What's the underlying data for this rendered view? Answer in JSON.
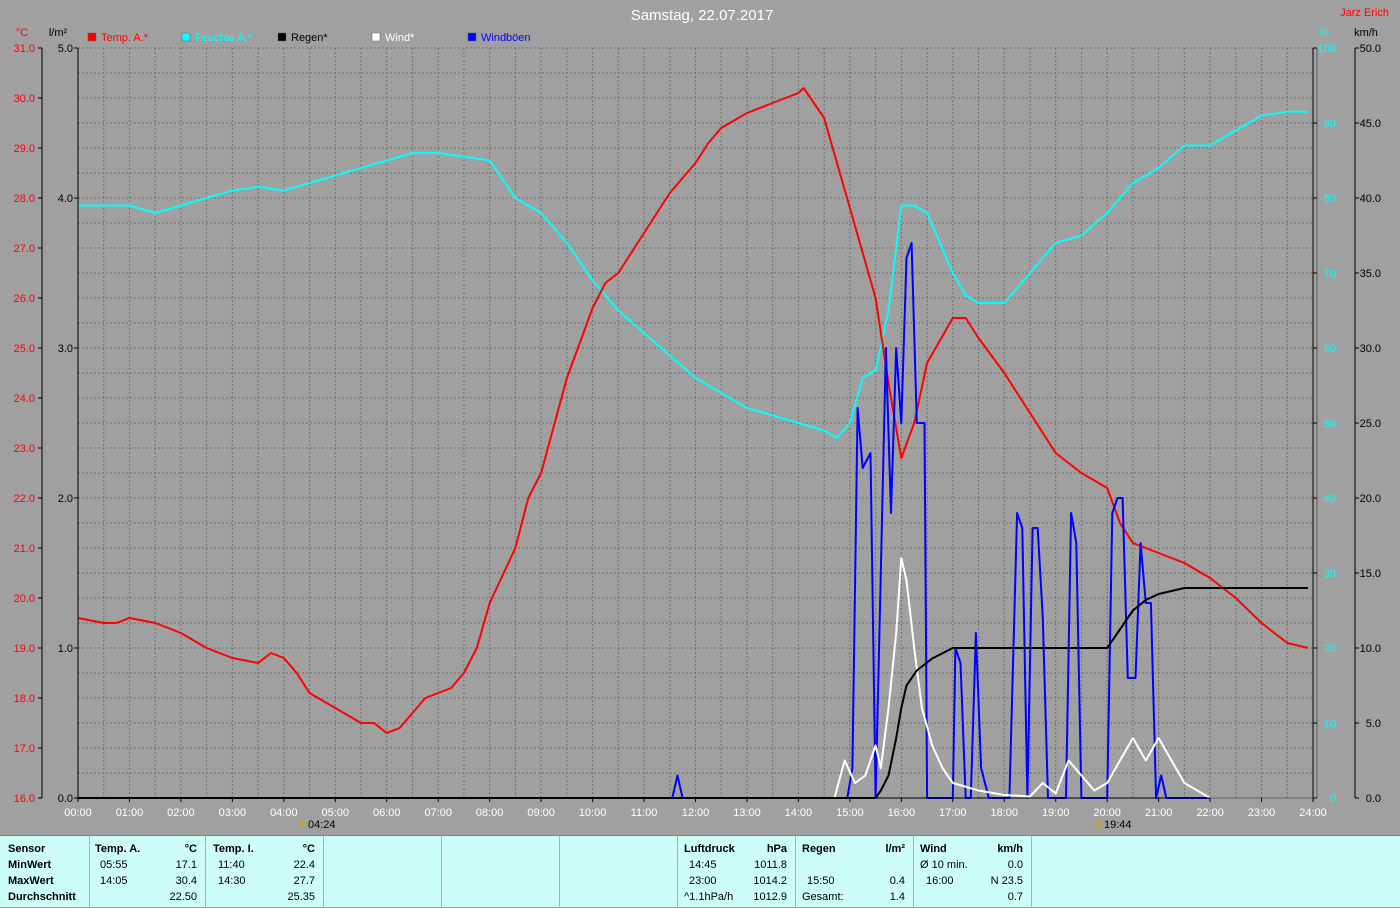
{
  "title": "Samstag, 22.07.2017",
  "author": "Jarz Erich",
  "units": {
    "left_temp": "°C",
    "left_rain": "l/m²",
    "right_km": "km/h",
    "right_pct": "%"
  },
  "legend": [
    {
      "label": "Temp. A.*",
      "color": "#ff0000"
    },
    {
      "label": "Feuchte A.*",
      "color": "#00ffff"
    },
    {
      "label": "Regen*",
      "color": "#000000"
    },
    {
      "label": "Wind*",
      "color": "#ffffff"
    },
    {
      "label": "Windböen",
      "color": "#0000ff"
    }
  ],
  "sunrise": "04:24",
  "sunset": "19:44",
  "chart_data": {
    "type": "line",
    "title": "Samstag, 22.07.2017",
    "x_ticks": [
      "00:00",
      "01:00",
      "02:00",
      "03:00",
      "04:00",
      "05:00",
      "06:00",
      "07:00",
      "08:00",
      "09:00",
      "10:00",
      "11:00",
      "12:00",
      "13:00",
      "14:00",
      "15:00",
      "16:00",
      "17:00",
      "18:00",
      "19:00",
      "20:00",
      "21:00",
      "22:00",
      "23:00",
      "24:00"
    ],
    "temp_axis": {
      "unit": "°C",
      "ylim": [
        16.0,
        31.0
      ],
      "ticks": [
        "16.0",
        "17.0",
        "18.0",
        "19.0",
        "20.0",
        "21.0",
        "22.0",
        "23.0",
        "24.0",
        "25.0",
        "26.0",
        "27.0",
        "28.0",
        "29.0",
        "30.0",
        "31.0"
      ]
    },
    "rain_axis": {
      "unit": "l/m²",
      "ylim": [
        0.0,
        5.0
      ],
      "ticks": [
        "0.0",
        "1.0",
        "2.0",
        "3.0",
        "4.0",
        "5.0"
      ]
    },
    "humidity_axis": {
      "unit": "%",
      "ylim": [
        0,
        100
      ],
      "ticks": [
        "0",
        "10",
        "20",
        "30",
        "40",
        "50",
        "60",
        "70",
        "80",
        "90",
        "100"
      ]
    },
    "wind_axis": {
      "unit": "km/h",
      "ylim": [
        0.0,
        50.0
      ],
      "ticks": [
        "0.0",
        "5.0",
        "10.0",
        "15.0",
        "20.0",
        "25.0",
        "30.0",
        "35.0",
        "40.0",
        "45.0",
        "50.0"
      ]
    },
    "series": [
      {
        "name": "Temp. A.*",
        "axis": "temp",
        "color": "#ff0000",
        "x": [
          0,
          0.5,
          0.75,
          1,
          1.5,
          1.75,
          2,
          2.5,
          3,
          3.5,
          3.75,
          4,
          4.25,
          4.5,
          5,
          5.5,
          5.75,
          6,
          6.25,
          6.5,
          6.75,
          7,
          7.25,
          7.5,
          7.75,
          8,
          8.5,
          8.75,
          9,
          9.5,
          10,
          10.25,
          10.5,
          11,
          11.5,
          12,
          12.25,
          12.5,
          13,
          13.5,
          13.75,
          14,
          14.1,
          14.5,
          15,
          15.5,
          15.75,
          16,
          16.25,
          16.5,
          17,
          17.25,
          17.5,
          18,
          18.5,
          19,
          19.5,
          20,
          20.25,
          20.5,
          21,
          21.5,
          22,
          22.5,
          23,
          23.5,
          23.9
        ],
        "y": [
          19.6,
          19.5,
          19.5,
          19.6,
          19.5,
          19.4,
          19.3,
          19.0,
          18.8,
          18.7,
          18.9,
          18.8,
          18.5,
          18.1,
          17.8,
          17.5,
          17.5,
          17.3,
          17.4,
          17.7,
          18.0,
          18.1,
          18.2,
          18.5,
          19.0,
          19.9,
          21.0,
          22.0,
          22.5,
          24.4,
          25.8,
          26.3,
          26.5,
          27.3,
          28.1,
          28.7,
          29.1,
          29.4,
          29.7,
          29.9,
          30.0,
          30.1,
          30.2,
          29.6,
          27.8,
          26.0,
          24.3,
          22.8,
          23.5,
          24.7,
          25.6,
          25.6,
          25.2,
          24.5,
          23.7,
          22.9,
          22.5,
          22.2,
          21.5,
          21.1,
          20.9,
          20.7,
          20.4,
          20.0,
          19.5,
          19.1,
          19.0
        ]
      },
      {
        "name": "Feuchte A.*",
        "axis": "humidity",
        "color": "#00ffff",
        "x": [
          0,
          0.5,
          1,
          1.5,
          2,
          2.5,
          3,
          3.5,
          4,
          4.5,
          5,
          5.5,
          6,
          6.5,
          7,
          7.5,
          8,
          8.5,
          9,
          9.5,
          10,
          10.5,
          11,
          11.5,
          12,
          12.5,
          13,
          13.5,
          14,
          14.5,
          14.75,
          15,
          15.25,
          15.5,
          15.75,
          16,
          16.25,
          16.5,
          17,
          17.25,
          17.5,
          18,
          18.25,
          18.5,
          19,
          19.5,
          20,
          20.5,
          21,
          21.5,
          22,
          22.5,
          23,
          23.5,
          23.9
        ],
        "y": [
          79,
          79,
          79,
          78,
          79,
          80,
          81,
          81.5,
          81,
          82,
          83,
          84,
          85,
          86,
          86,
          85.5,
          85,
          80,
          78,
          74,
          69,
          65,
          62,
          59,
          56,
          54,
          52,
          51,
          50,
          49,
          48,
          50,
          56,
          57,
          65,
          79,
          79,
          78,
          70,
          67,
          66,
          66,
          68,
          70,
          74,
          75,
          78,
          82,
          84,
          87,
          87,
          89,
          91,
          91.5,
          91.5
        ]
      },
      {
        "name": "Regen*",
        "axis": "rain",
        "color": "#000000",
        "x": [
          0,
          15.5,
          15.6,
          15.75,
          15.9,
          16.0,
          16.1,
          16.3,
          16.6,
          17,
          18,
          19,
          20.0,
          20.2,
          20.5,
          20.75,
          21,
          21.25,
          21.5,
          22,
          22.5,
          23,
          23.9
        ],
        "y": [
          0,
          0,
          0.05,
          0.15,
          0.4,
          0.6,
          0.75,
          0.85,
          0.93,
          1.0,
          1.0,
          1.0,
          1.0,
          1.1,
          1.25,
          1.32,
          1.36,
          1.38,
          1.4,
          1.4,
          1.4,
          1.4,
          1.4
        ]
      },
      {
        "name": "Wind*",
        "axis": "wind",
        "color": "#ffffff",
        "x": [
          0,
          14.7,
          14.9,
          15.1,
          15.3,
          15.5,
          15.6,
          15.75,
          15.9,
          16.0,
          16.1,
          16.25,
          16.4,
          16.6,
          16.8,
          17.0,
          17.5,
          18,
          18.5,
          18.75,
          19,
          19.25,
          19.5,
          19.75,
          20,
          20.25,
          20.5,
          20.75,
          21,
          21.25,
          21.5,
          22,
          24
        ],
        "y": [
          0,
          0,
          2.5,
          1.0,
          1.5,
          3.5,
          2.0,
          6.0,
          11.0,
          16.0,
          14.5,
          10.0,
          6.0,
          3.5,
          2.0,
          1.0,
          0.5,
          0.2,
          0.1,
          1.0,
          0.3,
          2.5,
          1.5,
          0.5,
          1.0,
          2.5,
          4.0,
          2.5,
          4.0,
          2.5,
          1.0,
          0,
          0
        ]
      },
      {
        "name": "Windböen",
        "axis": "wind",
        "color": "#0000ff",
        "x": [
          0,
          11.55,
          11.65,
          11.75,
          14.8,
          14.95,
          15.05,
          15.15,
          15.25,
          15.4,
          15.5,
          15.6,
          15.7,
          15.8,
          15.9,
          16.0,
          16.1,
          16.2,
          16.3,
          16.45,
          16.5,
          17.0,
          17.05,
          17.15,
          17.25,
          17.35,
          17.45,
          17.55,
          17.7,
          17.8,
          18.1,
          18.25,
          18.35,
          18.45,
          18.55,
          18.65,
          18.75,
          18.85,
          19.2,
          19.3,
          19.4,
          19.5,
          19.6,
          19.8,
          19.9,
          20.0,
          20.1,
          20.2,
          20.3,
          20.4,
          20.55,
          20.65,
          20.75,
          20.85,
          20.95,
          21.05,
          21.15,
          21.25,
          21.35,
          21.5,
          24
        ],
        "y": [
          0,
          0,
          1.5,
          0,
          0,
          0,
          2,
          26,
          22,
          23,
          0,
          15,
          30,
          19,
          30,
          25,
          36,
          37,
          25,
          25,
          0,
          0,
          10,
          9,
          0,
          0,
          11,
          2,
          0,
          0,
          0,
          19,
          18,
          0,
          18,
          18,
          12,
          0,
          0,
          19,
          17,
          0,
          0,
          0,
          0,
          0,
          19,
          20,
          20,
          8,
          8,
          17,
          13,
          13,
          0,
          1.5,
          0,
          0,
          0,
          0,
          0
        ]
      }
    ]
  },
  "table": {
    "sensor": {
      "header": "Sensor",
      "rows": [
        "MinWert",
        "MaxWert",
        "Durchschnitt"
      ]
    },
    "temp_a": {
      "header": "Temp. A.",
      "unit": "°C",
      "min_time": "05:55",
      "min_val": "17.1",
      "max_time": "14:05",
      "max_val": "30.4",
      "avg": "22.50"
    },
    "temp_i": {
      "header": "Temp. I.",
      "unit": "°C",
      "min_time": "11:40",
      "min_val": "22.4",
      "max_time": "14:30",
      "max_val": "27.7",
      "avg": "25.35"
    },
    "pressure": {
      "header": "Luftdruck",
      "unit": "hPa",
      "min_time": "14:45",
      "min_val": "1011.8",
      "max_time": "23:00",
      "max_val": "1014.2",
      "avg_label": "^1.1hPa/h",
      "avg": "1012.9"
    },
    "rain": {
      "header": "Regen",
      "unit": "l/m²",
      "max_time": "15:50",
      "max_val": "0.4",
      "avg_label": "Gesamt:",
      "avg": "1.4"
    },
    "wind": {
      "header": "Wind",
      "unit": "km/h",
      "min_time": "Ø 10 min.",
      "min_val": "0.0",
      "max_time": "16:00",
      "max_val": "N 23.5",
      "avg": "0.7"
    }
  }
}
